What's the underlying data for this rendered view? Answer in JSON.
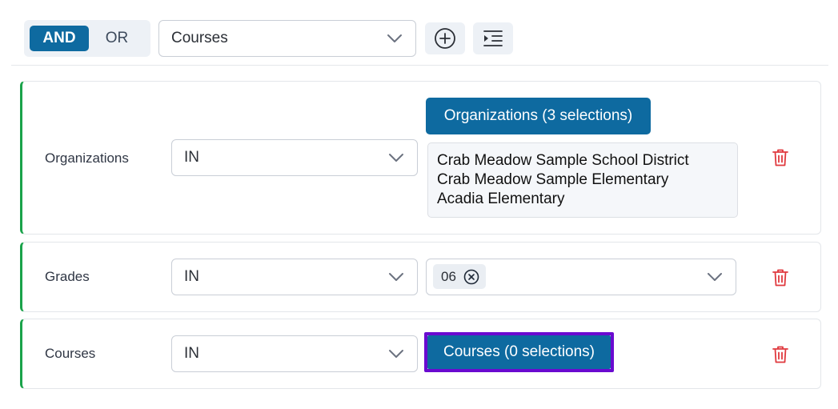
{
  "toolbar": {
    "and_label": "AND",
    "or_label": "OR",
    "field_select_value": "Courses"
  },
  "rows": [
    {
      "label": "Organizations",
      "operator": "IN",
      "button_label": "Organizations (3 selections)",
      "selections": [
        "Crab Meadow Sample School District",
        "Crab Meadow Sample Elementary",
        "Acadia Elementary"
      ]
    },
    {
      "label": "Grades",
      "operator": "IN",
      "tags": [
        "06"
      ]
    },
    {
      "label": "Courses",
      "operator": "IN",
      "button_label": "Courses (0 selections)"
    }
  ],
  "colors": {
    "primary": "#0e6aa0",
    "valid_border": "#1aa34a",
    "delete": "#e0393e",
    "focus": "#6a0ad0"
  }
}
